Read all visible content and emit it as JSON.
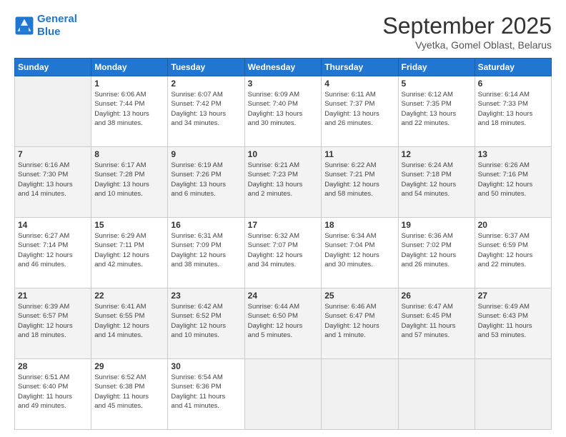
{
  "logo": {
    "line1": "General",
    "line2": "Blue"
  },
  "header": {
    "month": "September 2025",
    "location": "Vyetka, Gomel Oblast, Belarus"
  },
  "days_of_week": [
    "Sunday",
    "Monday",
    "Tuesday",
    "Wednesday",
    "Thursday",
    "Friday",
    "Saturday"
  ],
  "weeks": [
    [
      {
        "num": "",
        "info": ""
      },
      {
        "num": "1",
        "info": "Sunrise: 6:06 AM\nSunset: 7:44 PM\nDaylight: 13 hours\nand 38 minutes."
      },
      {
        "num": "2",
        "info": "Sunrise: 6:07 AM\nSunset: 7:42 PM\nDaylight: 13 hours\nand 34 minutes."
      },
      {
        "num": "3",
        "info": "Sunrise: 6:09 AM\nSunset: 7:40 PM\nDaylight: 13 hours\nand 30 minutes."
      },
      {
        "num": "4",
        "info": "Sunrise: 6:11 AM\nSunset: 7:37 PM\nDaylight: 13 hours\nand 26 minutes."
      },
      {
        "num": "5",
        "info": "Sunrise: 6:12 AM\nSunset: 7:35 PM\nDaylight: 13 hours\nand 22 minutes."
      },
      {
        "num": "6",
        "info": "Sunrise: 6:14 AM\nSunset: 7:33 PM\nDaylight: 13 hours\nand 18 minutes."
      }
    ],
    [
      {
        "num": "7",
        "info": "Sunrise: 6:16 AM\nSunset: 7:30 PM\nDaylight: 13 hours\nand 14 minutes."
      },
      {
        "num": "8",
        "info": "Sunrise: 6:17 AM\nSunset: 7:28 PM\nDaylight: 13 hours\nand 10 minutes."
      },
      {
        "num": "9",
        "info": "Sunrise: 6:19 AM\nSunset: 7:26 PM\nDaylight: 13 hours\nand 6 minutes."
      },
      {
        "num": "10",
        "info": "Sunrise: 6:21 AM\nSunset: 7:23 PM\nDaylight: 13 hours\nand 2 minutes."
      },
      {
        "num": "11",
        "info": "Sunrise: 6:22 AM\nSunset: 7:21 PM\nDaylight: 12 hours\nand 58 minutes."
      },
      {
        "num": "12",
        "info": "Sunrise: 6:24 AM\nSunset: 7:18 PM\nDaylight: 12 hours\nand 54 minutes."
      },
      {
        "num": "13",
        "info": "Sunrise: 6:26 AM\nSunset: 7:16 PM\nDaylight: 12 hours\nand 50 minutes."
      }
    ],
    [
      {
        "num": "14",
        "info": "Sunrise: 6:27 AM\nSunset: 7:14 PM\nDaylight: 12 hours\nand 46 minutes."
      },
      {
        "num": "15",
        "info": "Sunrise: 6:29 AM\nSunset: 7:11 PM\nDaylight: 12 hours\nand 42 minutes."
      },
      {
        "num": "16",
        "info": "Sunrise: 6:31 AM\nSunset: 7:09 PM\nDaylight: 12 hours\nand 38 minutes."
      },
      {
        "num": "17",
        "info": "Sunrise: 6:32 AM\nSunset: 7:07 PM\nDaylight: 12 hours\nand 34 minutes."
      },
      {
        "num": "18",
        "info": "Sunrise: 6:34 AM\nSunset: 7:04 PM\nDaylight: 12 hours\nand 30 minutes."
      },
      {
        "num": "19",
        "info": "Sunrise: 6:36 AM\nSunset: 7:02 PM\nDaylight: 12 hours\nand 26 minutes."
      },
      {
        "num": "20",
        "info": "Sunrise: 6:37 AM\nSunset: 6:59 PM\nDaylight: 12 hours\nand 22 minutes."
      }
    ],
    [
      {
        "num": "21",
        "info": "Sunrise: 6:39 AM\nSunset: 6:57 PM\nDaylight: 12 hours\nand 18 minutes."
      },
      {
        "num": "22",
        "info": "Sunrise: 6:41 AM\nSunset: 6:55 PM\nDaylight: 12 hours\nand 14 minutes."
      },
      {
        "num": "23",
        "info": "Sunrise: 6:42 AM\nSunset: 6:52 PM\nDaylight: 12 hours\nand 10 minutes."
      },
      {
        "num": "24",
        "info": "Sunrise: 6:44 AM\nSunset: 6:50 PM\nDaylight: 12 hours\nand 5 minutes."
      },
      {
        "num": "25",
        "info": "Sunrise: 6:46 AM\nSunset: 6:47 PM\nDaylight: 12 hours\nand 1 minute."
      },
      {
        "num": "26",
        "info": "Sunrise: 6:47 AM\nSunset: 6:45 PM\nDaylight: 11 hours\nand 57 minutes."
      },
      {
        "num": "27",
        "info": "Sunrise: 6:49 AM\nSunset: 6:43 PM\nDaylight: 11 hours\nand 53 minutes."
      }
    ],
    [
      {
        "num": "28",
        "info": "Sunrise: 6:51 AM\nSunset: 6:40 PM\nDaylight: 11 hours\nand 49 minutes."
      },
      {
        "num": "29",
        "info": "Sunrise: 6:52 AM\nSunset: 6:38 PM\nDaylight: 11 hours\nand 45 minutes."
      },
      {
        "num": "30",
        "info": "Sunrise: 6:54 AM\nSunset: 6:36 PM\nDaylight: 11 hours\nand 41 minutes."
      },
      {
        "num": "",
        "info": ""
      },
      {
        "num": "",
        "info": ""
      },
      {
        "num": "",
        "info": ""
      },
      {
        "num": "",
        "info": ""
      }
    ]
  ]
}
